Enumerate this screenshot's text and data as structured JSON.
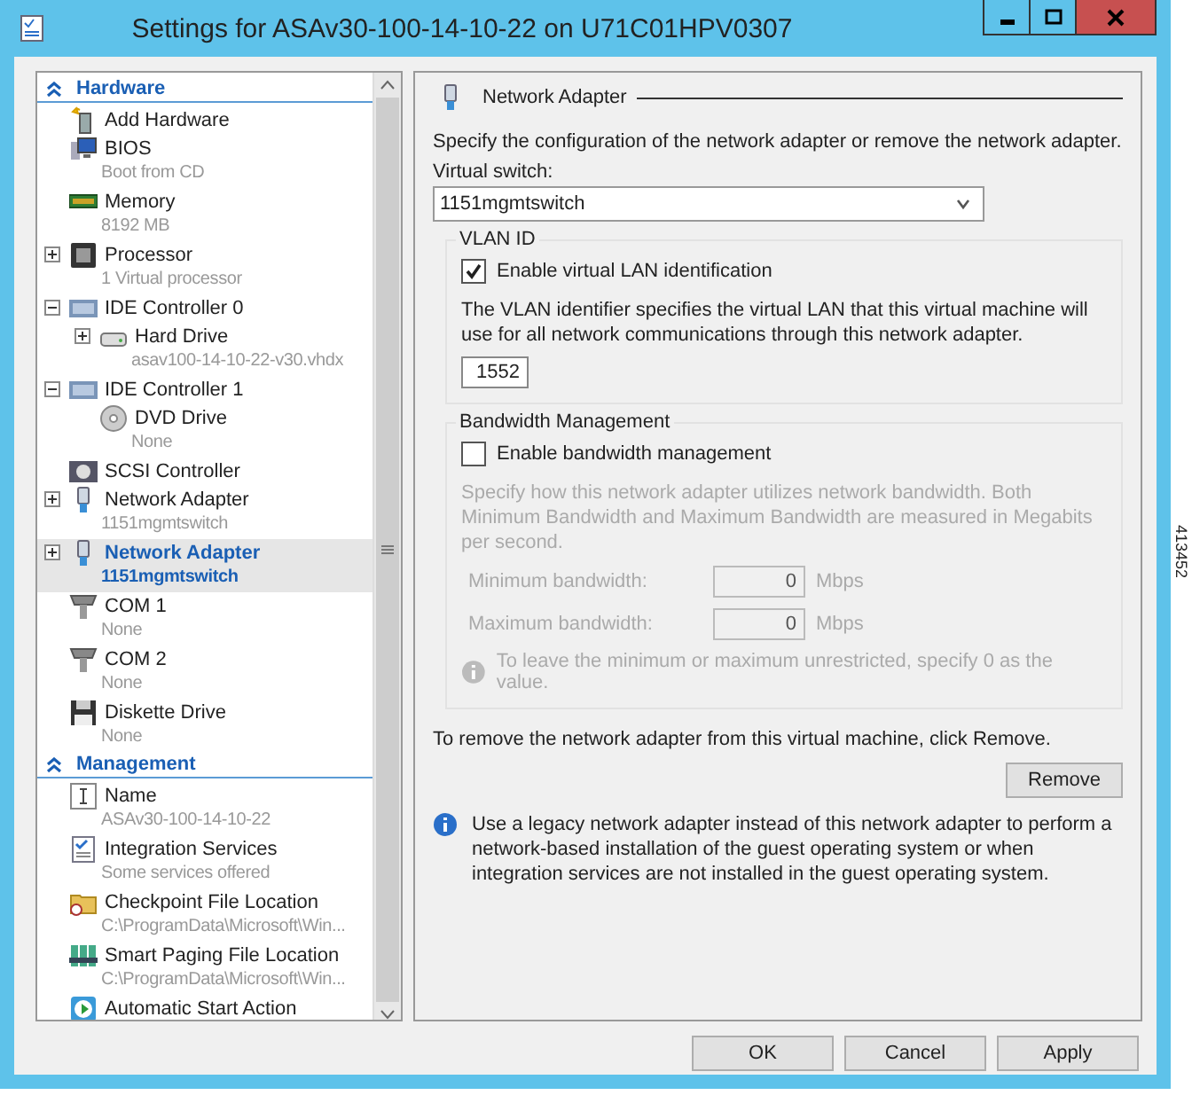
{
  "window": {
    "title": "Settings for ASAv30-100-14-10-22 on U71C01HPV0307"
  },
  "tree": {
    "sections": [
      {
        "title": "Hardware",
        "expanded": true,
        "items": [
          {
            "kind": "add",
            "name": "Add Hardware",
            "selected": false
          },
          {
            "kind": "bios",
            "name": "BIOS",
            "detail": "Boot from CD",
            "selected": false
          },
          {
            "kind": "memory",
            "name": "Memory",
            "detail": "8192 MB",
            "selected": false
          },
          {
            "kind": "processor",
            "name": "Processor",
            "detail": "1 Virtual processor",
            "expanded": false,
            "selected": false
          },
          {
            "kind": "controller",
            "name": "IDE Controller 0",
            "expanded": true,
            "selected": false,
            "children": [
              {
                "kind": "disk",
                "name": "Hard Drive",
                "detail": "asav100-14-10-22-v30.vhdx",
                "expanded": false,
                "selected": false
              }
            ]
          },
          {
            "kind": "controller",
            "name": "IDE Controller 1",
            "expanded": true,
            "selected": false,
            "children": [
              {
                "kind": "dvd",
                "name": "DVD Drive",
                "detail": "None",
                "selected": false
              }
            ]
          },
          {
            "kind": "scsi",
            "name": "SCSI Controller",
            "selected": false
          },
          {
            "kind": "network",
            "name": "Network Adapter",
            "detail": "1151mgmtswitch",
            "expanded": false,
            "selected": false
          },
          {
            "kind": "network",
            "name": "Network Adapter",
            "detail": "1151mgmtswitch",
            "expanded": false,
            "selected": true
          },
          {
            "kind": "com",
            "name": "COM 1",
            "detail": "None",
            "selected": false
          },
          {
            "kind": "com",
            "name": "COM 2",
            "detail": "None",
            "selected": false
          },
          {
            "kind": "floppy",
            "name": "Diskette Drive",
            "detail": "None",
            "selected": false
          }
        ]
      },
      {
        "title": "Management",
        "expanded": true,
        "items": [
          {
            "kind": "name",
            "name": "Name",
            "detail": "ASAv30-100-14-10-22",
            "selected": false
          },
          {
            "kind": "integration",
            "name": "Integration Services",
            "detail": "Some services offered",
            "selected": false
          },
          {
            "kind": "folder",
            "name": "Checkpoint File Location",
            "detail": "C:\\ProgramData\\Microsoft\\Win...",
            "selected": false
          },
          {
            "kind": "paging",
            "name": "Smart Paging File Location",
            "detail": "C:\\ProgramData\\Microsoft\\Win...",
            "selected": false
          },
          {
            "kind": "start",
            "name": "Automatic Start Action",
            "selected": false
          }
        ]
      }
    ]
  },
  "panel": {
    "heading": "Network Adapter",
    "description": "Specify the configuration of the network adapter or remove the network adapter.",
    "virtual_switch": {
      "label": "Virtual switch:",
      "value": "1151mgmtswitch"
    },
    "vlan": {
      "title": "VLAN ID",
      "checkbox": {
        "label": "Enable virtual LAN identification",
        "checked": true
      },
      "description": "The VLAN identifier specifies the virtual LAN that this virtual machine will use for all network communications through this network adapter.",
      "value": "1552"
    },
    "bandwidth": {
      "title": "Bandwidth Management",
      "checkbox": {
        "label": "Enable bandwidth management",
        "checked": false
      },
      "disabled": true,
      "description": "Specify how this network adapter utilizes network bandwidth. Both Minimum Bandwidth and Maximum Bandwidth are measured in Megabits per second.",
      "fields": [
        {
          "label": "Minimum bandwidth:",
          "value": "0",
          "unit": "Mbps"
        },
        {
          "label": "Maximum bandwidth:",
          "value": "0",
          "unit": "Mbps"
        }
      ],
      "note": "To leave the minimum or maximum unrestricted, specify 0 as the value."
    },
    "remove_text": "To remove the network adapter from this virtual machine, click Remove.",
    "remove_button": "Remove",
    "info": "Use a legacy network adapter instead of this network adapter to perform a network-based installation of the guest operating system or when integration services are not installed in the guest operating system."
  },
  "buttons": [
    "OK",
    "Cancel",
    "Apply"
  ],
  "figure_number": "413452"
}
